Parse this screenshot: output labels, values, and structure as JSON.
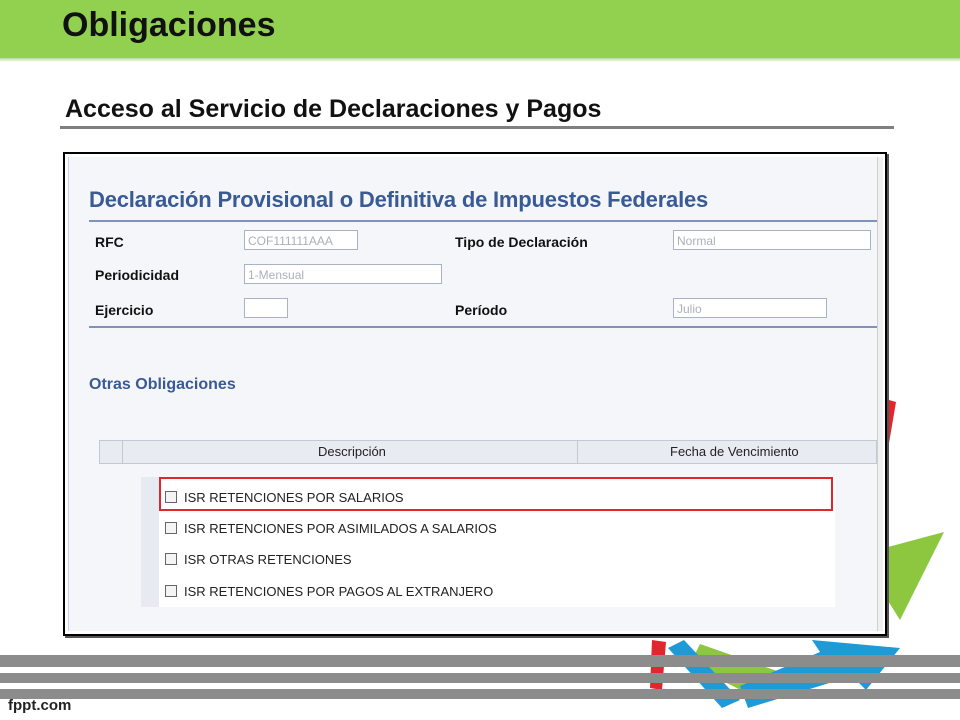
{
  "slide": {
    "title": "Obligaciones",
    "subtitle": "Acceso al Servicio de Declaraciones y Pagos",
    "footer": "fppt.com"
  },
  "form": {
    "title": "Declaración Provisional o Definitiva de Impuestos Federales",
    "fields": {
      "rfc_label": "RFC",
      "rfc_value": "COF111111AAA",
      "tipo_label": "Tipo de Declaración",
      "tipo_value": "Normal",
      "periodicidad_label": "Periodicidad",
      "periodicidad_value": "1-Mensual",
      "ejercicio_label": "Ejercicio",
      "ejercicio_value": "",
      "periodo_label": "Período",
      "periodo_value": "Julio"
    }
  },
  "obligaciones": {
    "section_title": "Otras Obligaciones",
    "columns": [
      "Descripción",
      "Fecha de Vencimiento"
    ],
    "rows": [
      {
        "label": "ISR RETENCIONES POR SALARIOS",
        "checked": false,
        "highlighted": true
      },
      {
        "label": "ISR RETENCIONES POR ASIMILADOS A SALARIOS",
        "checked": false,
        "highlighted": false
      },
      {
        "label": "ISR OTRAS RETENCIONES",
        "checked": false,
        "highlighted": false
      },
      {
        "label": "ISR RETENCIONES POR PAGOS AL EXTRANJERO",
        "checked": false,
        "highlighted": false
      }
    ]
  },
  "colors": {
    "title_bar": "#92d050",
    "form_heading": "#3a5a96",
    "highlight_box": "#e3262e",
    "deco_red": "#e3262e",
    "deco_green": "#8dc63f",
    "deco_blue": "#1e9ad6"
  }
}
